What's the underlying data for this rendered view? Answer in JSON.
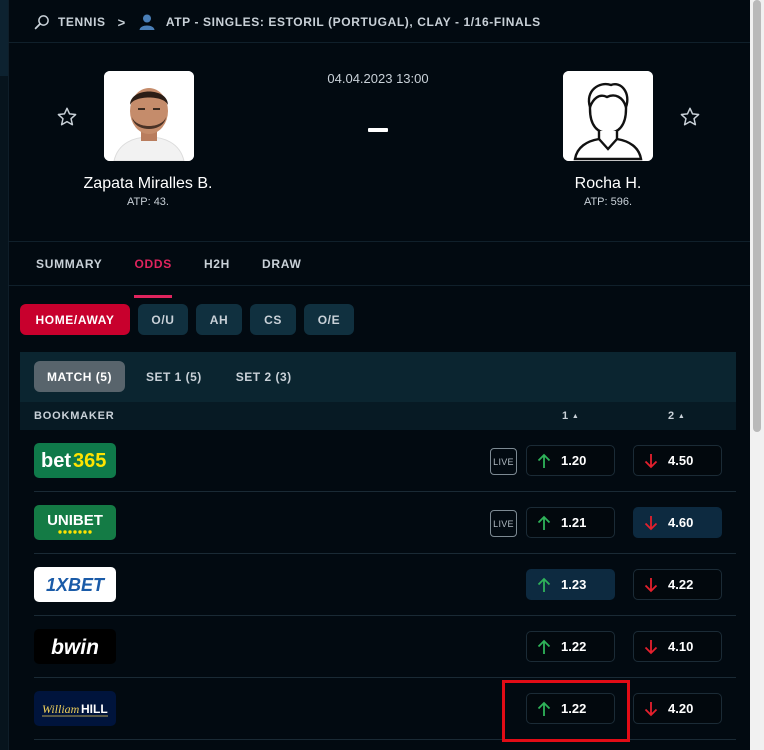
{
  "breadcrumb": {
    "sport": "TENNIS",
    "tournament": "ATP - SINGLES: ESTORIL (PORTUGAL), CLAY - 1/16-FINALS"
  },
  "match": {
    "datetime": "04.04.2023 13:00",
    "home": {
      "name": "Zapata Miralles B.",
      "rank": "ATP: 43."
    },
    "away": {
      "name": "Rocha H.",
      "rank": "ATP: 596."
    }
  },
  "tabs": [
    "SUMMARY",
    "ODDS",
    "H2H",
    "DRAW"
  ],
  "active_tab": "ODDS",
  "market_pills": [
    "HOME/AWAY",
    "O/U",
    "AH",
    "CS",
    "O/E"
  ],
  "sub_tabs": [
    "MATCH (5)",
    "SET 1 (5)",
    "SET 2 (3)"
  ],
  "columns": {
    "bookmaker": "BOOKMAKER",
    "col1": "1",
    "col2": "2"
  },
  "live_label": "LIVE",
  "bookmakers": [
    {
      "name": "bet365",
      "live": true,
      "odd1": "1.20",
      "dir1": "up",
      "odd2": "4.50",
      "dir2": "down",
      "hl": ""
    },
    {
      "name": "UNIBET",
      "live": true,
      "odd1": "1.21",
      "dir1": "up",
      "odd2": "4.60",
      "dir2": "down",
      "hl": "2"
    },
    {
      "name": "1XBET",
      "live": false,
      "odd1": "1.23",
      "dir1": "up",
      "odd2": "4.22",
      "dir2": "down",
      "hl": "1"
    },
    {
      "name": "bwin",
      "live": false,
      "odd1": "1.22",
      "dir1": "up",
      "odd2": "4.10",
      "dir2": "down",
      "hl": ""
    },
    {
      "name": "William HILL",
      "live": false,
      "odd1": "1.22",
      "dir1": "up",
      "odd2": "4.20",
      "dir2": "down",
      "hl": ""
    }
  ],
  "colors": {
    "background": "#020a11",
    "accent": "#e0245e",
    "active_pill": "#c8002d",
    "arrow_up": "#2fb35a",
    "arrow_down": "#e5202d",
    "highlight_box": "#e20c16"
  }
}
